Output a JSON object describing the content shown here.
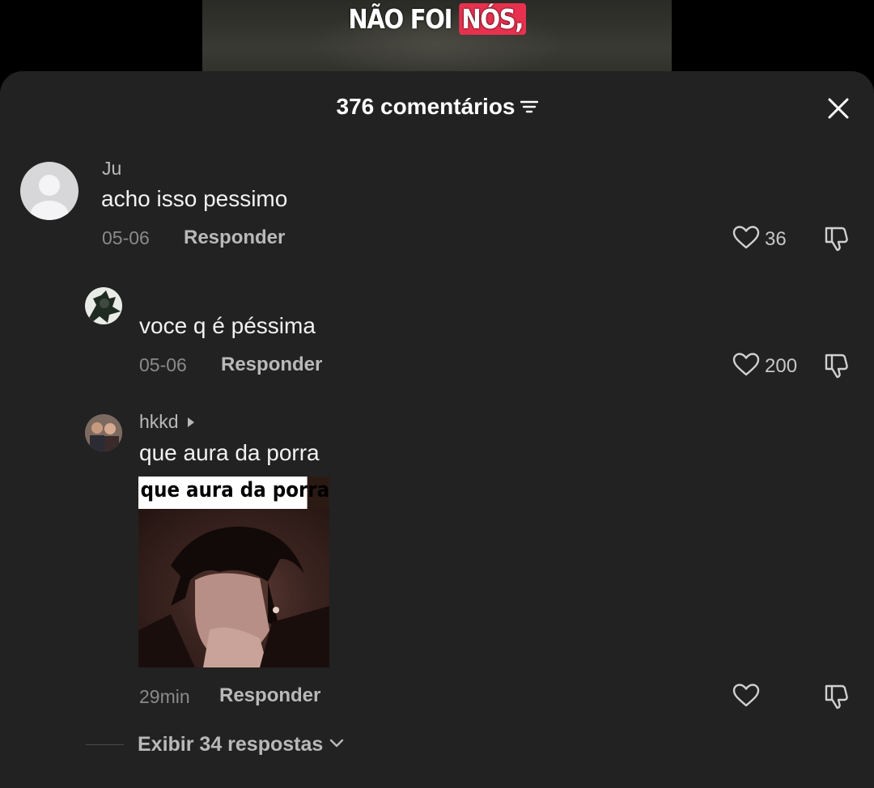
{
  "video": {
    "caption_plain": "NÃO FOI",
    "caption_highlight": "NÓS,"
  },
  "header": {
    "comment_count_label": "376 comentários"
  },
  "comments": [
    {
      "author": "Ju",
      "text": "acho isso pessimo",
      "date": "05-06",
      "reply_label": "Responder",
      "likes": "36"
    },
    {
      "author": "",
      "text": "voce q é péssima",
      "date": "05-06",
      "reply_label": "Responder",
      "likes": "200"
    },
    {
      "author": "hkkd",
      "text": "que aura da porra",
      "sticker_text": "que aura da porra",
      "date": "29min",
      "reply_label": "Responder",
      "likes": ""
    }
  ],
  "view_replies_label": "Exibir 34 respostas",
  "colors": {
    "sheet_bg": "#222222",
    "caption_highlight": "#e8314f"
  }
}
